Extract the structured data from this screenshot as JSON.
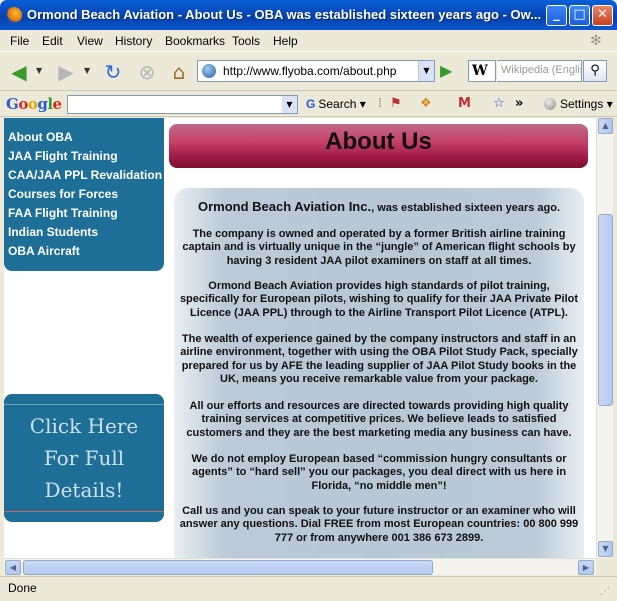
{
  "window": {
    "title": "Ormond Beach Aviation - About Us - OBA was established sixteen years ago - Ow..."
  },
  "menu": [
    "File",
    "Edit",
    "View",
    "History",
    "Bookmarks",
    "Tools",
    "Help"
  ],
  "nav": {
    "url": "http://www.flyoba.com/about.php",
    "search_engine_glyph": "W",
    "search_placeholder": "Wikipedia (English)"
  },
  "google_toolbar": {
    "logo": [
      "G",
      "o",
      "o",
      "g",
      "l",
      "e"
    ],
    "search_label": "Search",
    "settings_label": "Settings",
    "more_label": "»"
  },
  "sidebar": {
    "items": [
      "About OBA",
      "JAA Flight Training",
      "CAA/JAA PPL Revalidation",
      "Courses for Forces",
      "FAA Flight Training",
      "Indian Students",
      "OBA Aircraft"
    ],
    "promo": [
      "Click Here",
      "For Full",
      "Details!"
    ]
  },
  "page": {
    "heading": "About Us",
    "intro_name": "Ormond Beach Aviation Inc.",
    "intro_rest": ", was established sixteen years ago.",
    "paragraphs": [
      "The company is owned and operated by a former British airline training captain and is virtually unique in the “jungle” of American flight schools by having 3 resident JAA pilot examiners on staff at all times.",
      "Ormond Beach Aviation provides high standards of pilot training, specifically for European pilots, wishing to qualify for their JAA Private Pilot Licence (JAA PPL) through to the Airline Transport Pilot Licence (ATPL).",
      "The wealth of experience gained by the company instructors and staff in an airline environment, together with using the OBA Pilot Study Pack, specially prepared for us by AFE the leading supplier of JAA Pilot Study books in the UK, means you receive remarkable value from your package.",
      "All our efforts and resources are directed towards providing high quality training services at competitive prices. We believe leads to satisfied customers and they are the best marketing media any business can have.",
      "We do not employ European based “commission hungry consultants or agents” to “hard sell” you our packages, you deal direct with us here in Florida, “no middle men”!",
      "Call us and you can speak to your future instructor or an examiner who will answer any questions. Dial FREE from most European countries: 00 800 999 777 or from anywhere 001 386 673 2899."
    ]
  },
  "status": "Done",
  "colors": {
    "sidebar_bg": "#1e6f98",
    "banner": "#c5406a",
    "panel": "#b7c7d4"
  }
}
